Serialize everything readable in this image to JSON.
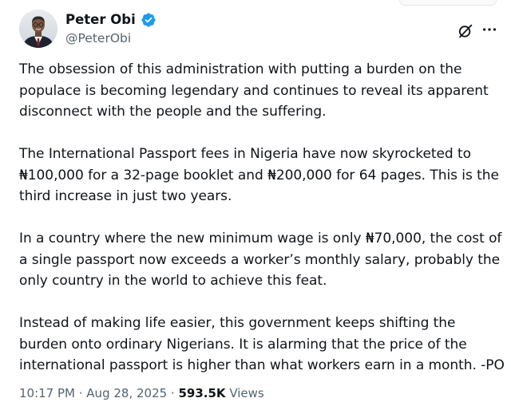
{
  "author": {
    "display_name": "Peter Obi",
    "handle": "@PeterObi",
    "verified": true,
    "verified_color": "#1d9bf0"
  },
  "icons": {
    "avatar": "profile-photo",
    "verified": "verified-badge-icon",
    "grok": "grok-icon",
    "more": "more-options-icon"
  },
  "post": {
    "paragraphs": [
      "The obsession of this administration with putting a burden on the populace is becoming legendary and continues to reveal its apparent disconnect with the people and the suffering.",
      "The International Passport fees in Nigeria have now skyrocketed to ₦100,000 for a 32-page booklet and ₦200,000 for 64 pages. This is the third increase in just two years.",
      "In a country where the new minimum wage is only ₦70,000, the cost of a single passport now exceeds a worker’s monthly salary, probably the only country in the world to achieve this feat.",
      "Instead of making life easier, this government keeps shifting the burden onto ordinary Nigerians. It is alarming that the price of the international passport is higher than what workers earn in a month. -PO"
    ]
  },
  "meta": {
    "time": "10:17 PM",
    "separator": " · ",
    "date": "Aug 28, 2025",
    "views_count": "593.5K",
    "views_label": " Views"
  },
  "colors": {
    "text": "#0f1419",
    "secondary": "#536471"
  }
}
